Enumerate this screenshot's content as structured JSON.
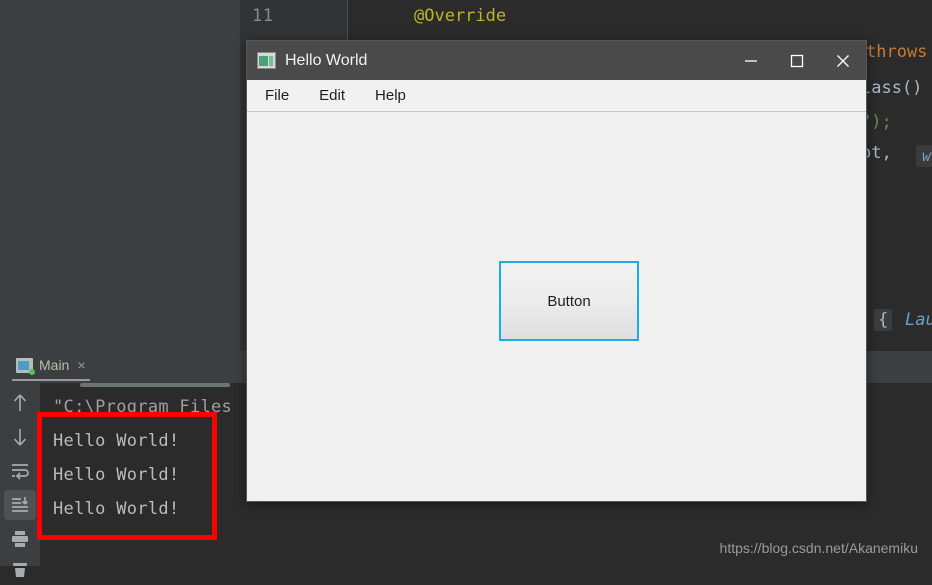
{
  "ide": {
    "editor": {
      "line_number": "11",
      "code_lines": [
        {
          "text": "@Override",
          "token": "annotation"
        },
        {
          "text": "throws",
          "token": "keyword"
        },
        {
          "text": "lass()",
          "token": "type"
        },
        {
          "text": "\");",
          "token": "string"
        },
        {
          "text": "ot,",
          "token": "ident"
        }
      ],
      "hint_chip": "w",
      "lambda_brace": "{",
      "lambda_hint": "Lau"
    },
    "run_panel": {
      "tab_label": "Main",
      "tab_close_glyph": "×",
      "tab_icon": "run-configuration-icon",
      "toolbar_buttons": [
        {
          "name": "up-arrow-icon",
          "glyph": "↑",
          "active": false
        },
        {
          "name": "down-arrow-icon",
          "glyph": "↓",
          "active": false
        },
        {
          "name": "soft-wrap-icon",
          "glyph": "↵",
          "active": false
        },
        {
          "name": "scroll-to-end-icon",
          "glyph": "↧",
          "active": true
        },
        {
          "name": "print-icon",
          "glyph": "⎙",
          "active": false
        },
        {
          "name": "trash-icon",
          "glyph": "Ὕ1",
          "active": false
        }
      ],
      "console_lines": [
        {
          "text": "\"C:\\Program Files",
          "kind": "cmd"
        },
        {
          "text": "Hello World!",
          "kind": "out"
        },
        {
          "text": "Hello World!",
          "kind": "out"
        },
        {
          "text": "Hello World!",
          "kind": "out"
        }
      ]
    },
    "annotation": {
      "name": "red-highlight-box",
      "color": "#ff0000"
    },
    "watermark": "https://blog.csdn.net/Akanemiku"
  },
  "dialog": {
    "title": "Hello World",
    "icon_name": "app-window-icon",
    "window_controls": [
      {
        "name": "minimize-button",
        "label": "Minimize"
      },
      {
        "name": "maximize-button",
        "label": "Maximize"
      },
      {
        "name": "close-button",
        "label": "Close"
      }
    ],
    "menu": [
      {
        "name": "menu-file",
        "label": "File"
      },
      {
        "name": "menu-edit",
        "label": "Edit"
      },
      {
        "name": "menu-help",
        "label": "Help"
      }
    ],
    "button": {
      "label": "Button",
      "focus_color": "#1eaae4"
    }
  }
}
